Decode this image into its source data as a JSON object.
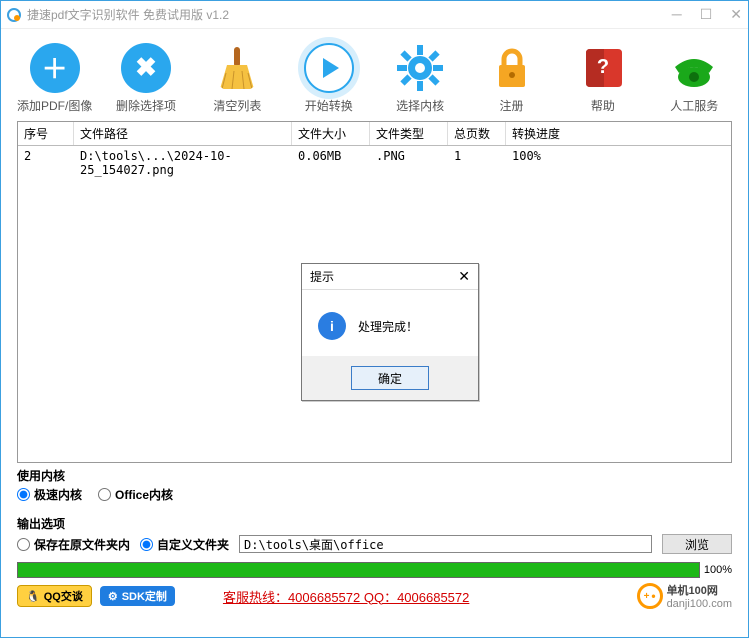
{
  "title": "捷速pdf文字识别软件 免费试用版 v1.2",
  "toolbar": {
    "add": "添加PDF/图像",
    "del": "删除选择项",
    "clear": "清空列表",
    "start": "开始转换",
    "kernel": "选择内核",
    "reg": "注册",
    "help": "帮助",
    "service": "人工服务"
  },
  "table": {
    "headers": {
      "seq": "序号",
      "path": "文件路径",
      "size": "文件大小",
      "type": "文件类型",
      "pages": "总页数",
      "prog": "转换进度"
    },
    "rows": [
      {
        "seq": "2",
        "path": "D:\\tools\\...\\2024-10-25_154027.png",
        "size": "0.06MB",
        "type": ".PNG",
        "pages": "1",
        "prog": "100%"
      }
    ]
  },
  "dialog": {
    "title": "提示",
    "msg": "处理完成！",
    "ok": "确定"
  },
  "kernelSection": {
    "title": "使用内核",
    "opt1": "极速内核",
    "opt2": "Office内核"
  },
  "outputSection": {
    "title": "输出选项",
    "opt1": "保存在原文件夹内",
    "opt2": "自定义文件夹",
    "path": "D:\\tools\\桌面\\office",
    "browse": "浏览"
  },
  "progress": {
    "pct": "100%"
  },
  "footer": {
    "qq": "QQ交谈",
    "sdk": "SDK定制",
    "hotline": "客服热线：4006685572 QQ：4006685572",
    "brand1": "单机100网",
    "brand2": "danji100.com"
  }
}
